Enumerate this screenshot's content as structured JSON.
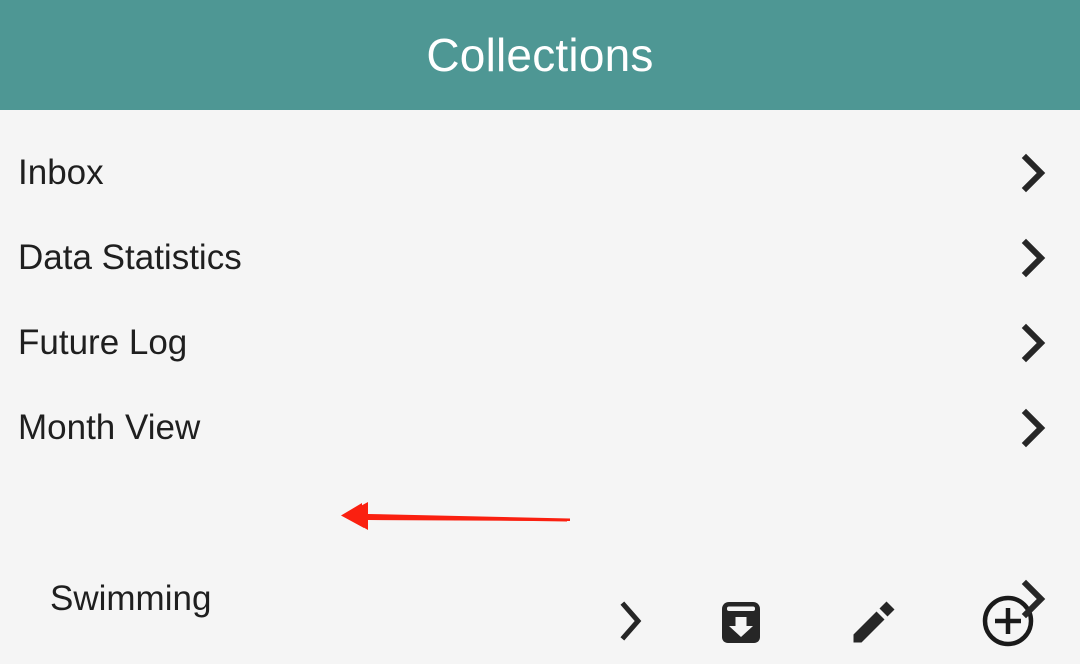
{
  "header": {
    "title": "Collections",
    "background_color": "#4e9794",
    "text_color": "#ffffff"
  },
  "page": {
    "background_color": "#f5f5f5",
    "text_color": "#1f1f1f"
  },
  "list": {
    "items": [
      {
        "label": "Inbox",
        "indent": 0,
        "chevron_icon": "chevron-right-icon"
      },
      {
        "label": "Data Statistics",
        "indent": 0,
        "chevron_icon": "chevron-right-icon"
      },
      {
        "label": "Future Log",
        "indent": 0,
        "chevron_icon": "chevron-right-icon"
      },
      {
        "label": "Month View",
        "indent": 0,
        "chevron_icon": "chevron-right-icon"
      },
      {
        "label": "Swimming",
        "indent": 1,
        "chevron_icon": "chevron-right-icon"
      }
    ]
  },
  "action_row": {
    "actions": [
      {
        "icon": "chevron-right-icon",
        "name": "expand-collection-button"
      },
      {
        "icon": "archive-down-icon",
        "name": "archive-collection-button"
      },
      {
        "icon": "pencil-icon",
        "name": "edit-collection-button"
      },
      {
        "icon": "plus-circle-icon",
        "name": "add-collection-button"
      }
    ]
  },
  "annotation": {
    "type": "arrow",
    "direction": "left",
    "color": "#fa2010"
  }
}
